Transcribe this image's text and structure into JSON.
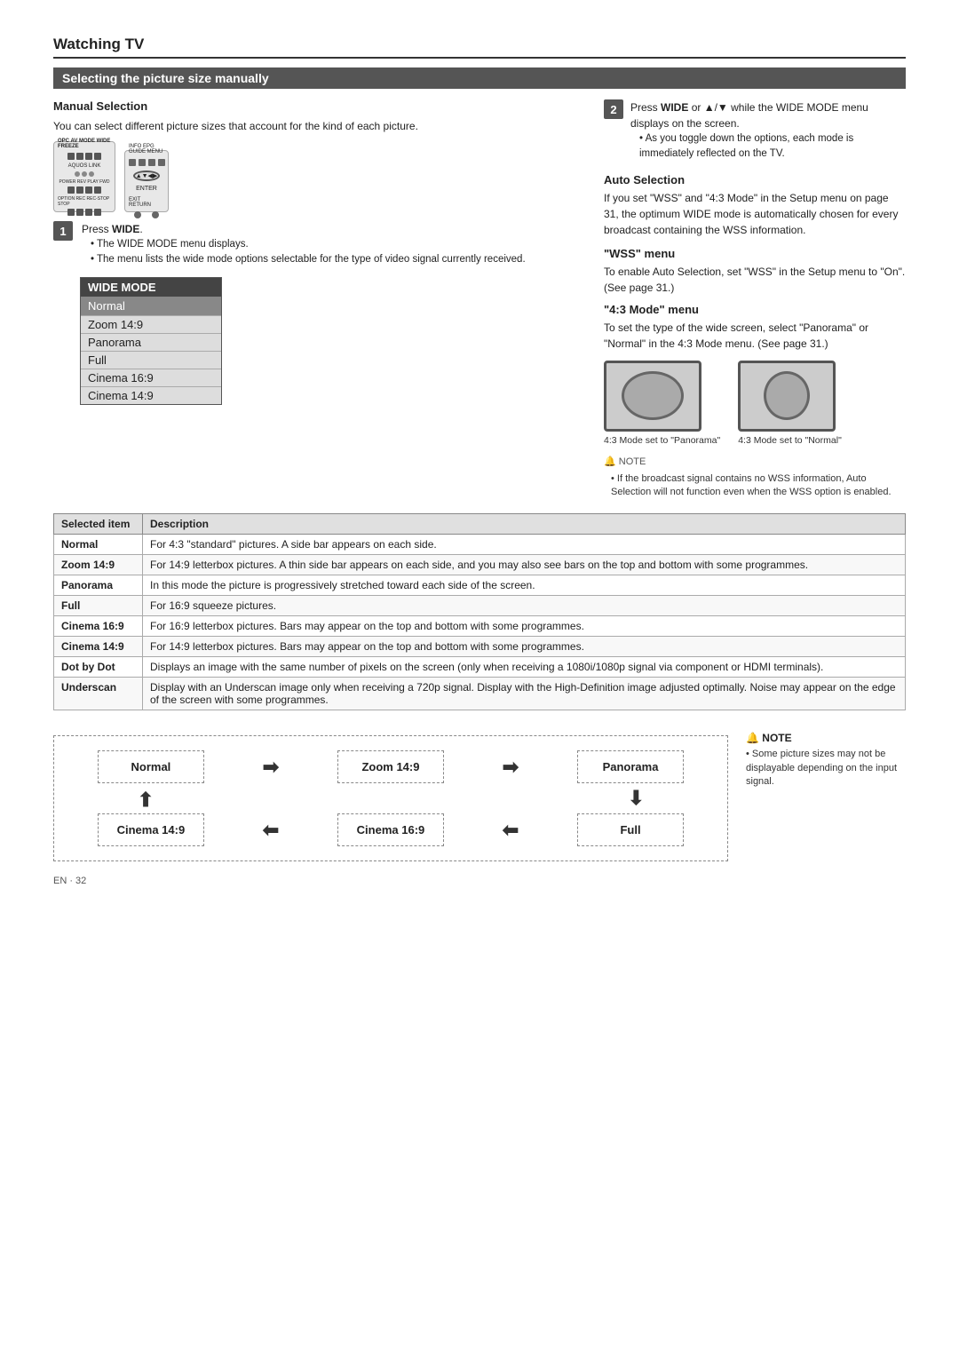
{
  "page": {
    "title": "Watching TV",
    "section_header": "Selecting the picture size manually",
    "page_number": "EN · 32"
  },
  "manual_selection": {
    "title": "Manual Selection",
    "body": "You can select different picture sizes that account for the kind of each picture."
  },
  "step1": {
    "number": "1",
    "action": "Press WIDE.",
    "bullets": [
      "The WIDE MODE menu displays.",
      "The menu lists the wide mode options selectable for the type of video signal currently received."
    ]
  },
  "step2": {
    "number": "2",
    "action_prefix": "Press ",
    "action_bold": "WIDE",
    "action_suffix": " or ▲/▼ while the WIDE MODE menu displays on the screen.",
    "bullet": "As you toggle down the options, each mode is immediately reflected on the TV."
  },
  "wide_mode_menu": {
    "header": "WIDE MODE",
    "selected": "Normal",
    "items": [
      "Zoom 14:9",
      "Panorama",
      "Full",
      "Cinema 16:9",
      "Cinema 14:9"
    ]
  },
  "auto_selection": {
    "title": "Auto Selection",
    "body": "If you set \"WSS\" and \"4:3 Mode\" in the Setup menu on page 31, the optimum WIDE mode is automatically chosen for every broadcast containing the WSS information."
  },
  "wss_menu": {
    "title": "\"WSS\" menu",
    "body": "To enable Auto Selection, set \"WSS\" in the Setup menu to \"On\". (See page 31.)"
  },
  "mode43_menu": {
    "title": "\"4:3 Mode\" menu",
    "body": "To set the type of the wide screen, select \"Panorama\" or \"Normal\" in the 4:3 Mode menu. (See page 31.)"
  },
  "tv_screens": [
    {
      "caption": "4:3 Mode set to \"Panorama\""
    },
    {
      "caption": "4:3 Mode set to \"Normal\""
    }
  ],
  "note1": {
    "text": "If the broadcast signal contains no WSS information, Auto Selection will not function even when the WSS option is enabled."
  },
  "table": {
    "headers": [
      "Selected item",
      "Description"
    ],
    "rows": [
      {
        "item": "Normal",
        "desc": "For 4:3 \"standard\" pictures. A side bar appears on each side."
      },
      {
        "item": "Zoom 14:9",
        "desc": "For 14:9 letterbox pictures. A thin side bar appears on each side, and you may also see bars on the top and bottom with some programmes."
      },
      {
        "item": "Panorama",
        "desc": "In this mode the picture is progressively stretched toward each side of the screen."
      },
      {
        "item": "Full",
        "desc": "For 16:9 squeeze pictures."
      },
      {
        "item": "Cinema 16:9",
        "desc": "For 16:9 letterbox pictures. Bars may appear on the top and bottom with some programmes."
      },
      {
        "item": "Cinema 14:9",
        "desc": "For 14:9 letterbox pictures. Bars may appear on the top and bottom with some programmes."
      },
      {
        "item": "Dot by Dot",
        "desc": "Displays an image with the same number of pixels on the screen (only when receiving a 1080i/1080p signal via component or HDMI terminals)."
      },
      {
        "item": "Underscan",
        "desc": "Display with an Underscan image only when receiving a 720p signal. Display with the High-Definition image adjusted optimally. Noise may appear on the edge of the screen with some programmes."
      }
    ]
  },
  "flow": {
    "box1": "Normal",
    "box2": "Zoom 14:9",
    "box3": "Panorama",
    "box4": "Cinema 14:9",
    "box5": "Cinema 16:9",
    "box6": "Full"
  },
  "note2": {
    "text": "Some picture sizes may not be displayable depending on the input signal."
  }
}
